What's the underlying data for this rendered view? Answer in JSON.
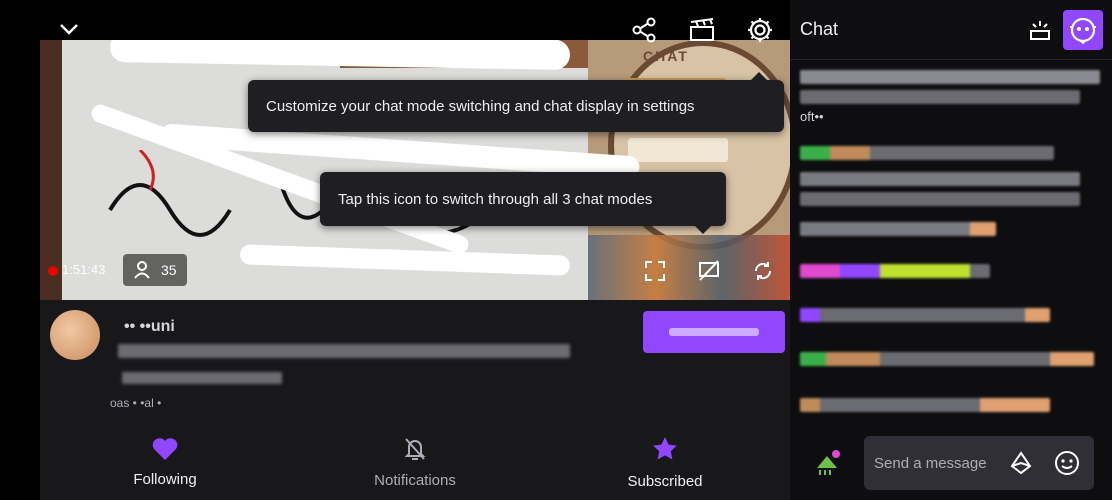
{
  "colors": {
    "accent": "#9147ff",
    "background": "#0e0e10",
    "panel": "#18181b",
    "live": "#eb0400",
    "tooltip_bg": "#1f1f23"
  },
  "top_bar": {
    "icons": [
      "chevron-down-icon",
      "share-icon",
      "clip-icon",
      "gear-icon"
    ]
  },
  "video": {
    "uptime": "1:51:43",
    "viewer_count": "35",
    "overlay_badge": "CHAT",
    "controls": [
      "fullscreen-icon",
      "chat-mode-icon",
      "rotate-icon"
    ]
  },
  "tooltips": {
    "settings": "Customize your chat mode switching and chat display in settings",
    "chat_modes": "Tap this icon to switch through all 3 chat modes"
  },
  "channel": {
    "name": "•• ••uni",
    "tag_text": "oas • •al •"
  },
  "bottom_nav": {
    "items": [
      {
        "label": "Following",
        "icon": "heart-icon"
      },
      {
        "label": "Notifications",
        "icon": "bell-off-icon"
      },
      {
        "label": "Subscribed",
        "icon": "star-icon"
      }
    ]
  },
  "chat": {
    "title": "Chat",
    "snippet": "oft••",
    "input_placeholder": "Send a message",
    "header_icons": [
      "community-highlight-icon",
      "bot-avatar-icon"
    ],
    "input_icons": [
      "sticker-icon",
      "bits-icon",
      "emote-icon"
    ]
  }
}
